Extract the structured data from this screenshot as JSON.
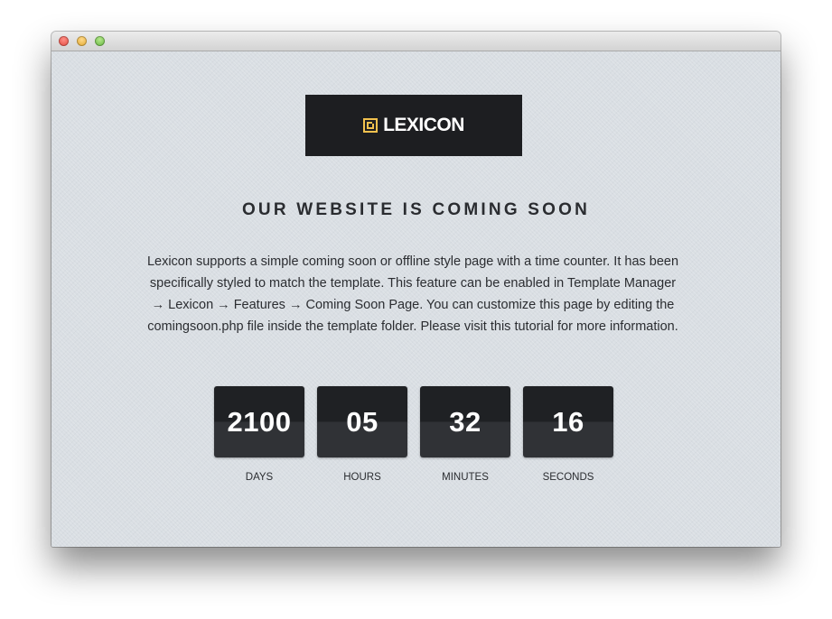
{
  "window": {
    "controls": [
      "close",
      "minimize",
      "maximize"
    ]
  },
  "logo": {
    "text": "LEXICON",
    "icon": "lexicon-logo-mark",
    "icon_color": "#f2c14e"
  },
  "headline": "OUR WEBSITE IS COMING SOON",
  "description": "Lexicon supports a simple coming soon or offline style page with a time counter. It has been specifically styled to match the template. This feature can be enabled in Template Manager → Lexicon → Features → Coming Soon Page. You can customize this page by editing the comingsoon.php file inside the template folder. Please visit this tutorial for more information.",
  "countdown": [
    {
      "value": "2100",
      "label": "DAYS"
    },
    {
      "value": "05",
      "label": "HOURS"
    },
    {
      "value": "32",
      "label": "MINUTES"
    },
    {
      "value": "16",
      "label": "SECONDS"
    }
  ],
  "colors": {
    "background": "#d9dee3",
    "dark": "#1d1e21",
    "accent": "#f2c14e"
  }
}
